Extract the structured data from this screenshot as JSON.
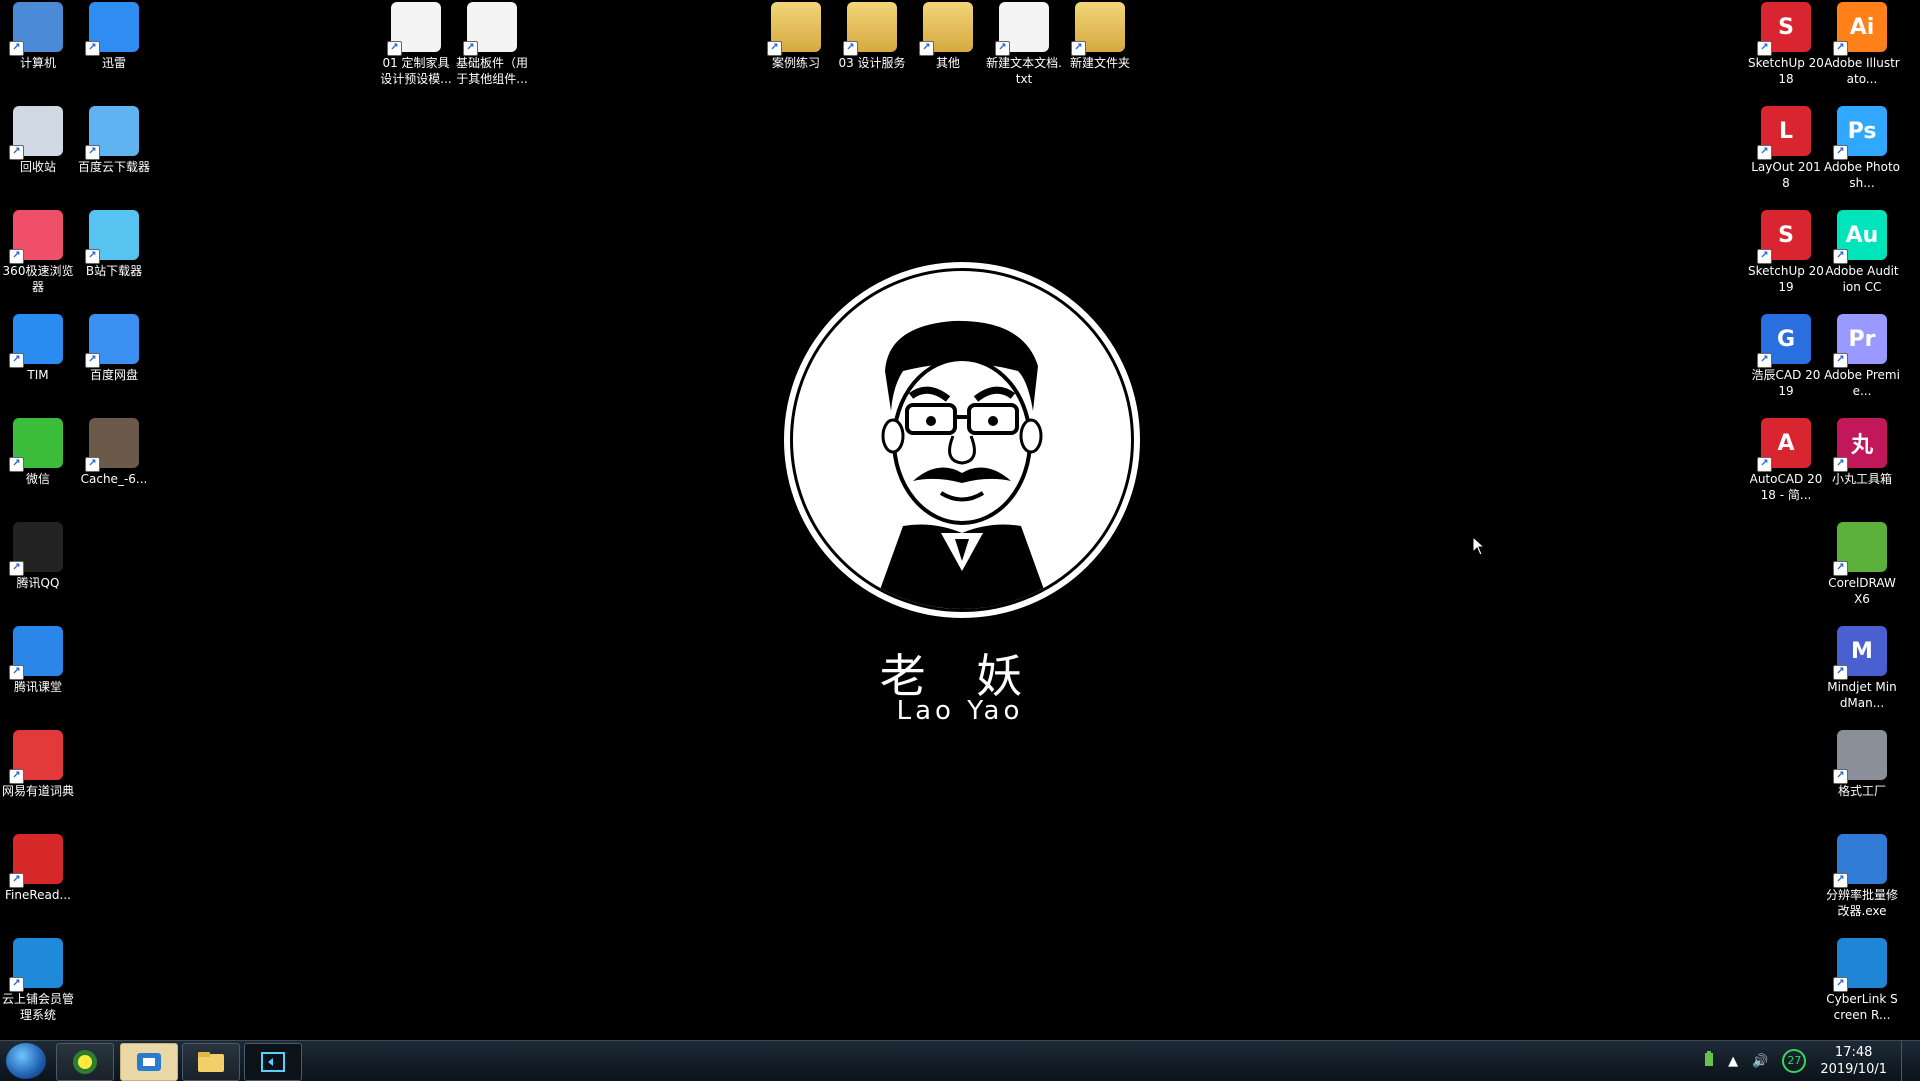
{
  "desktop": {
    "left_icons": [
      {
        "label": "计算机",
        "icon": "computer-icon",
        "color": "#4a8ad6"
      },
      {
        "label": "迅雷",
        "icon": "xunlei-icon",
        "color": "#2f8df2"
      },
      {
        "label": "回收站",
        "icon": "recycle-bin-icon",
        "color": "#cfd8e3"
      },
      {
        "label": "百度云下载器",
        "icon": "baidu-cloud-icon",
        "color": "#5fb3f0"
      },
      {
        "label": "360极速浏览器",
        "icon": "browser-360-icon",
        "color": "#f04f6a"
      },
      {
        "label": "B站下载器",
        "icon": "bilibili-icon",
        "color": "#56c3f0"
      },
      {
        "label": "TIM",
        "icon": "tim-icon",
        "color": "#2a8cf0"
      },
      {
        "label": "百度网盘",
        "icon": "baidu-netdisk-icon",
        "color": "#3b8ff0"
      },
      {
        "label": "微信",
        "icon": "wechat-icon",
        "color": "#3bbd3b"
      },
      {
        "label": "Cache_-6...",
        "icon": "image-file-icon",
        "color": "#6b5a4a"
      },
      {
        "label": "腾讯QQ",
        "icon": "qq-icon",
        "color": "#222"
      },
      {
        "label": "腾讯课堂",
        "icon": "tencent-classroom-icon",
        "color": "#2a86e8"
      },
      {
        "label": "网易有道词典",
        "icon": "youdao-icon",
        "color": "#e23a3a"
      },
      {
        "label": "FineRead...",
        "icon": "finereader-icon",
        "color": "#d62828"
      },
      {
        "label": "云上铺会员管理系统",
        "icon": "yunshangpu-icon",
        "color": "#1f8ad9"
      }
    ],
    "top_icons": [
      {
        "label": "01 定制家具设计预设模...",
        "icon": "sketchup-file-icon",
        "kind": "doc"
      },
      {
        "label": "基础板件（用于其他组件...",
        "icon": "sketchup-file-icon",
        "kind": "doc"
      },
      {
        "label": "案例练习",
        "icon": "folder-icon",
        "kind": "folder"
      },
      {
        "label": "03 设计服务",
        "icon": "folder-icon",
        "kind": "folder"
      },
      {
        "label": "其他",
        "icon": "folder-icon",
        "kind": "folder"
      },
      {
        "label": "新建文本文档.txt",
        "icon": "text-file-icon",
        "kind": "doc"
      },
      {
        "label": "新建文件夹",
        "icon": "folder-icon",
        "kind": "folder"
      }
    ],
    "right_icons": [
      {
        "label": "SketchUp 2018",
        "icon": "sketchup-icon",
        "color": "#d9252f",
        "text": "S"
      },
      {
        "label": "Adobe Illustrato...",
        "icon": "illustrator-icon",
        "color": "#ff7f18",
        "text": "Ai"
      },
      {
        "label": "LayOut 2018",
        "icon": "layout-icon",
        "color": "#d9252f",
        "text": "L"
      },
      {
        "label": "Adobe Photosh...",
        "icon": "photoshop-icon",
        "color": "#31a8ff",
        "text": "Ps"
      },
      {
        "label": "SketchUp 2019",
        "icon": "sketchup-icon",
        "color": "#d9252f",
        "text": "S"
      },
      {
        "label": "Adobe Audition CC",
        "icon": "audition-icon",
        "color": "#00e4bb",
        "text": "Au"
      },
      {
        "label": "浩辰CAD 2019",
        "icon": "gstarcad-icon",
        "color": "#2a6fe0",
        "text": "G"
      },
      {
        "label": "Adobe Premie...",
        "icon": "premiere-icon",
        "color": "#9999ff",
        "text": "Pr"
      },
      {
        "label": "AutoCAD 2018 - 简...",
        "icon": "autocad-icon",
        "color": "#d9252f",
        "text": "A"
      },
      {
        "label": "小丸工具箱",
        "icon": "xiaowan-icon",
        "color": "#c2185b",
        "text": "丸"
      },
      {
        "label": "CorelDRAW X6",
        "icon": "coreldraw-icon",
        "color": "#5ab03a",
        "text": ""
      },
      {
        "label": "Mindjet MindMan...",
        "icon": "mindmanager-icon",
        "color": "#4a5fd0",
        "text": "M"
      },
      {
        "label": "格式工厂",
        "icon": "format-factory-icon",
        "color": "#8a8f99",
        "text": ""
      },
      {
        "label": "分辨率批量修改器.exe",
        "icon": "resolution-tool-icon",
        "color": "#2f7bd6",
        "text": ""
      },
      {
        "label": "CyberLink Screen R...",
        "icon": "cyberlink-icon",
        "color": "#1f86d6",
        "text": ""
      }
    ],
    "center": {
      "name_cn": "老 妖",
      "name_en": "Lao Yao"
    }
  },
  "taskbar": {
    "start_icon": "windows-start-icon",
    "pinned": [
      {
        "name": "360-icon"
      },
      {
        "name": "video-app-icon"
      },
      {
        "name": "file-explorer-icon"
      },
      {
        "name": "screen-recorder-icon"
      }
    ],
    "tray": {
      "badge": "27",
      "time": "17:48",
      "date": "2019/10/1"
    }
  }
}
